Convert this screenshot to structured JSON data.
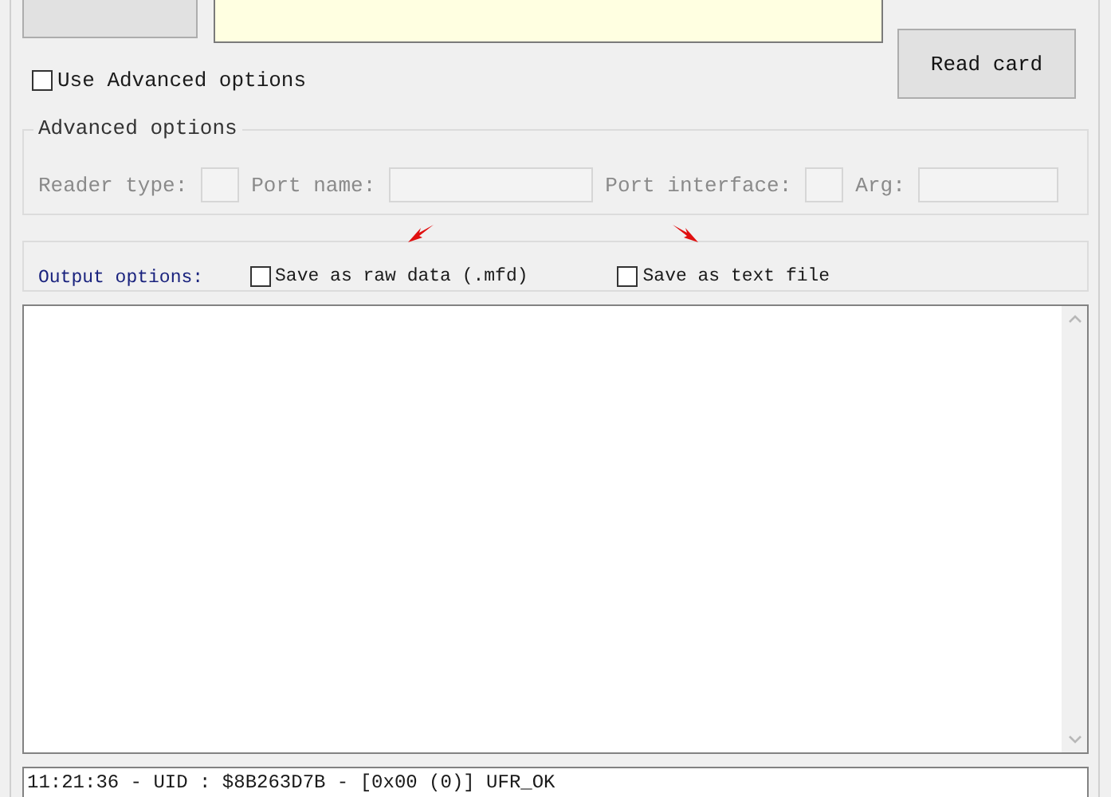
{
  "read_button": {
    "label": "Read card"
  },
  "use_advanced": {
    "label": "Use Advanced options",
    "checked": false
  },
  "advanced_options": {
    "title": "Advanced options",
    "disabled": true,
    "fields": [
      {
        "label": "Reader type:"
      },
      {
        "label": "Port name:"
      },
      {
        "label": "Port interface:"
      },
      {
        "label": "Arg:"
      }
    ]
  },
  "output_options": {
    "label": "Output options:",
    "options": [
      {
        "label": "Save as raw data (.mfd)",
        "checked": false
      },
      {
        "label": "Save as text file",
        "checked": false
      }
    ]
  },
  "status_line": "11:21:36 - UID : $8B263D7B - [0x00 (0)] UFR_OK"
}
